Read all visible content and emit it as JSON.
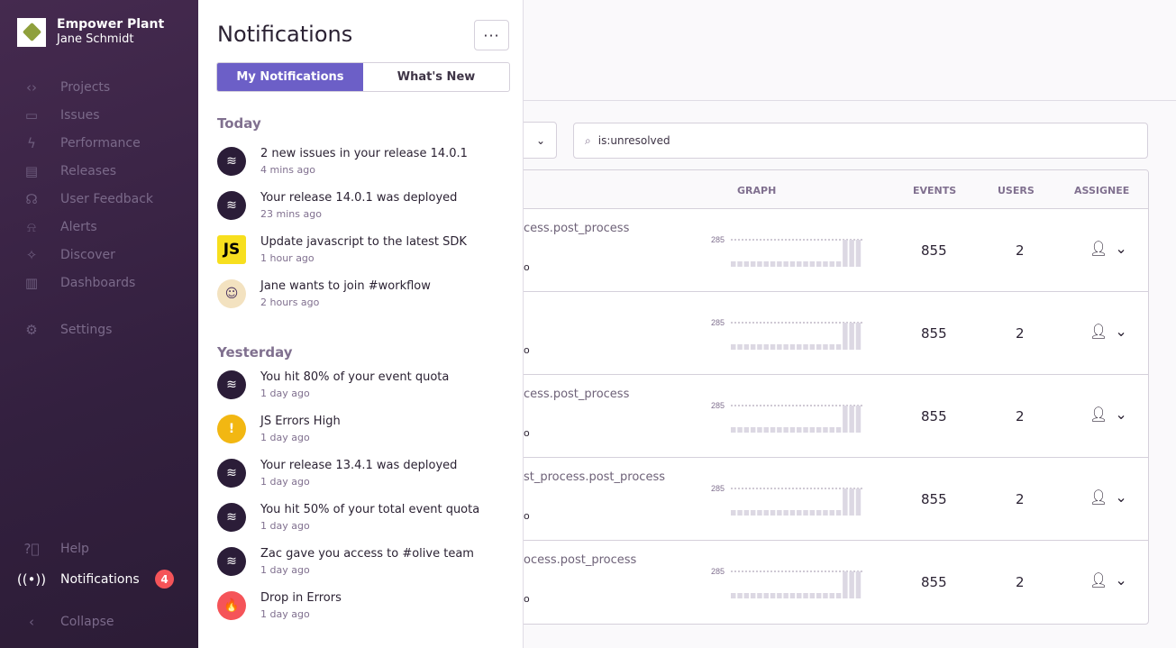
{
  "sidebar": {
    "org": "Empower Plant",
    "user": "Jane Schmidt",
    "items": [
      {
        "label": "Projects",
        "icon": "folder-code-icon"
      },
      {
        "label": "Issues",
        "icon": "inbox-icon"
      },
      {
        "label": "Performance",
        "icon": "lightning-icon"
      },
      {
        "label": "Releases",
        "icon": "package-icon"
      },
      {
        "label": "User Feedback",
        "icon": "megaphone-icon"
      },
      {
        "label": "Alerts",
        "icon": "siren-icon"
      },
      {
        "label": "Discover",
        "icon": "telescope-icon"
      },
      {
        "label": "Dashboards",
        "icon": "dashboard-icon"
      }
    ],
    "settings": "Settings",
    "help": "Help",
    "notifications": "Notifications",
    "notifications_count": "4",
    "collapse": "Collapse"
  },
  "panel": {
    "title": "Notifications",
    "more": "···",
    "tabs": [
      "My Notifications",
      "What's New"
    ],
    "today_label": "Today",
    "yesterday_label": "Yesterday",
    "today": [
      {
        "text": "2 new issues in your release 14.0.1",
        "time": "4 mins ago",
        "icon": "sentry"
      },
      {
        "text": "Your release 14.0.1 was deployed",
        "time": "23 mins ago",
        "icon": "sentry"
      },
      {
        "text": "Update javascript to the latest SDK",
        "time": "1 hour ago",
        "icon": "js",
        "glyph": "JS"
      },
      {
        "text": "Jane wants to join #workflow",
        "time": "2 hours ago",
        "icon": "user"
      }
    ],
    "yesterday": [
      {
        "text": "You hit 80% of your event quota",
        "time": "1 day ago",
        "icon": "sentry"
      },
      {
        "text": "JS Errors High",
        "time": "1 day ago",
        "icon": "warn",
        "glyph": "!"
      },
      {
        "text": "Your release 13.4.1 was deployed",
        "time": "1 day ago",
        "icon": "sentry"
      },
      {
        "text": "You hit 50% of your total event quota",
        "time": "1 day ago",
        "icon": "sentry"
      },
      {
        "text": "Zac gave you access to #olive team",
        "time": "1 day ago",
        "icon": "sentry"
      },
      {
        "text": "Drop in Errors",
        "time": "1 day ago",
        "icon": "fire"
      }
    ]
  },
  "main": {
    "search": "is:unresolved",
    "columns": {
      "graph": "GRAPH",
      "events": "EVENTS",
      "users": "USERS",
      "assignee": "ASSIGNEE"
    },
    "rows": [
      {
        "title": "cess.post_process",
        "sub": "o",
        "events": "855",
        "users": "2",
        "max": "285"
      },
      {
        "title": "",
        "sub": "o",
        "events": "855",
        "users": "2",
        "max": "285"
      },
      {
        "title": "cess.post_process",
        "sub": "o",
        "events": "855",
        "users": "2",
        "max": "285"
      },
      {
        "title": "st_process.post_process",
        "sub": "o",
        "events": "855",
        "users": "2",
        "max": "285"
      },
      {
        "title": "ocess.post_process",
        "sub": "o",
        "events": "855",
        "users": "2",
        "max": "285"
      }
    ],
    "spark_values": [
      20,
      20,
      20,
      20,
      20,
      20,
      20,
      20,
      20,
      20,
      20,
      20,
      20,
      20,
      20,
      20,
      20,
      285,
      285,
      285
    ]
  }
}
